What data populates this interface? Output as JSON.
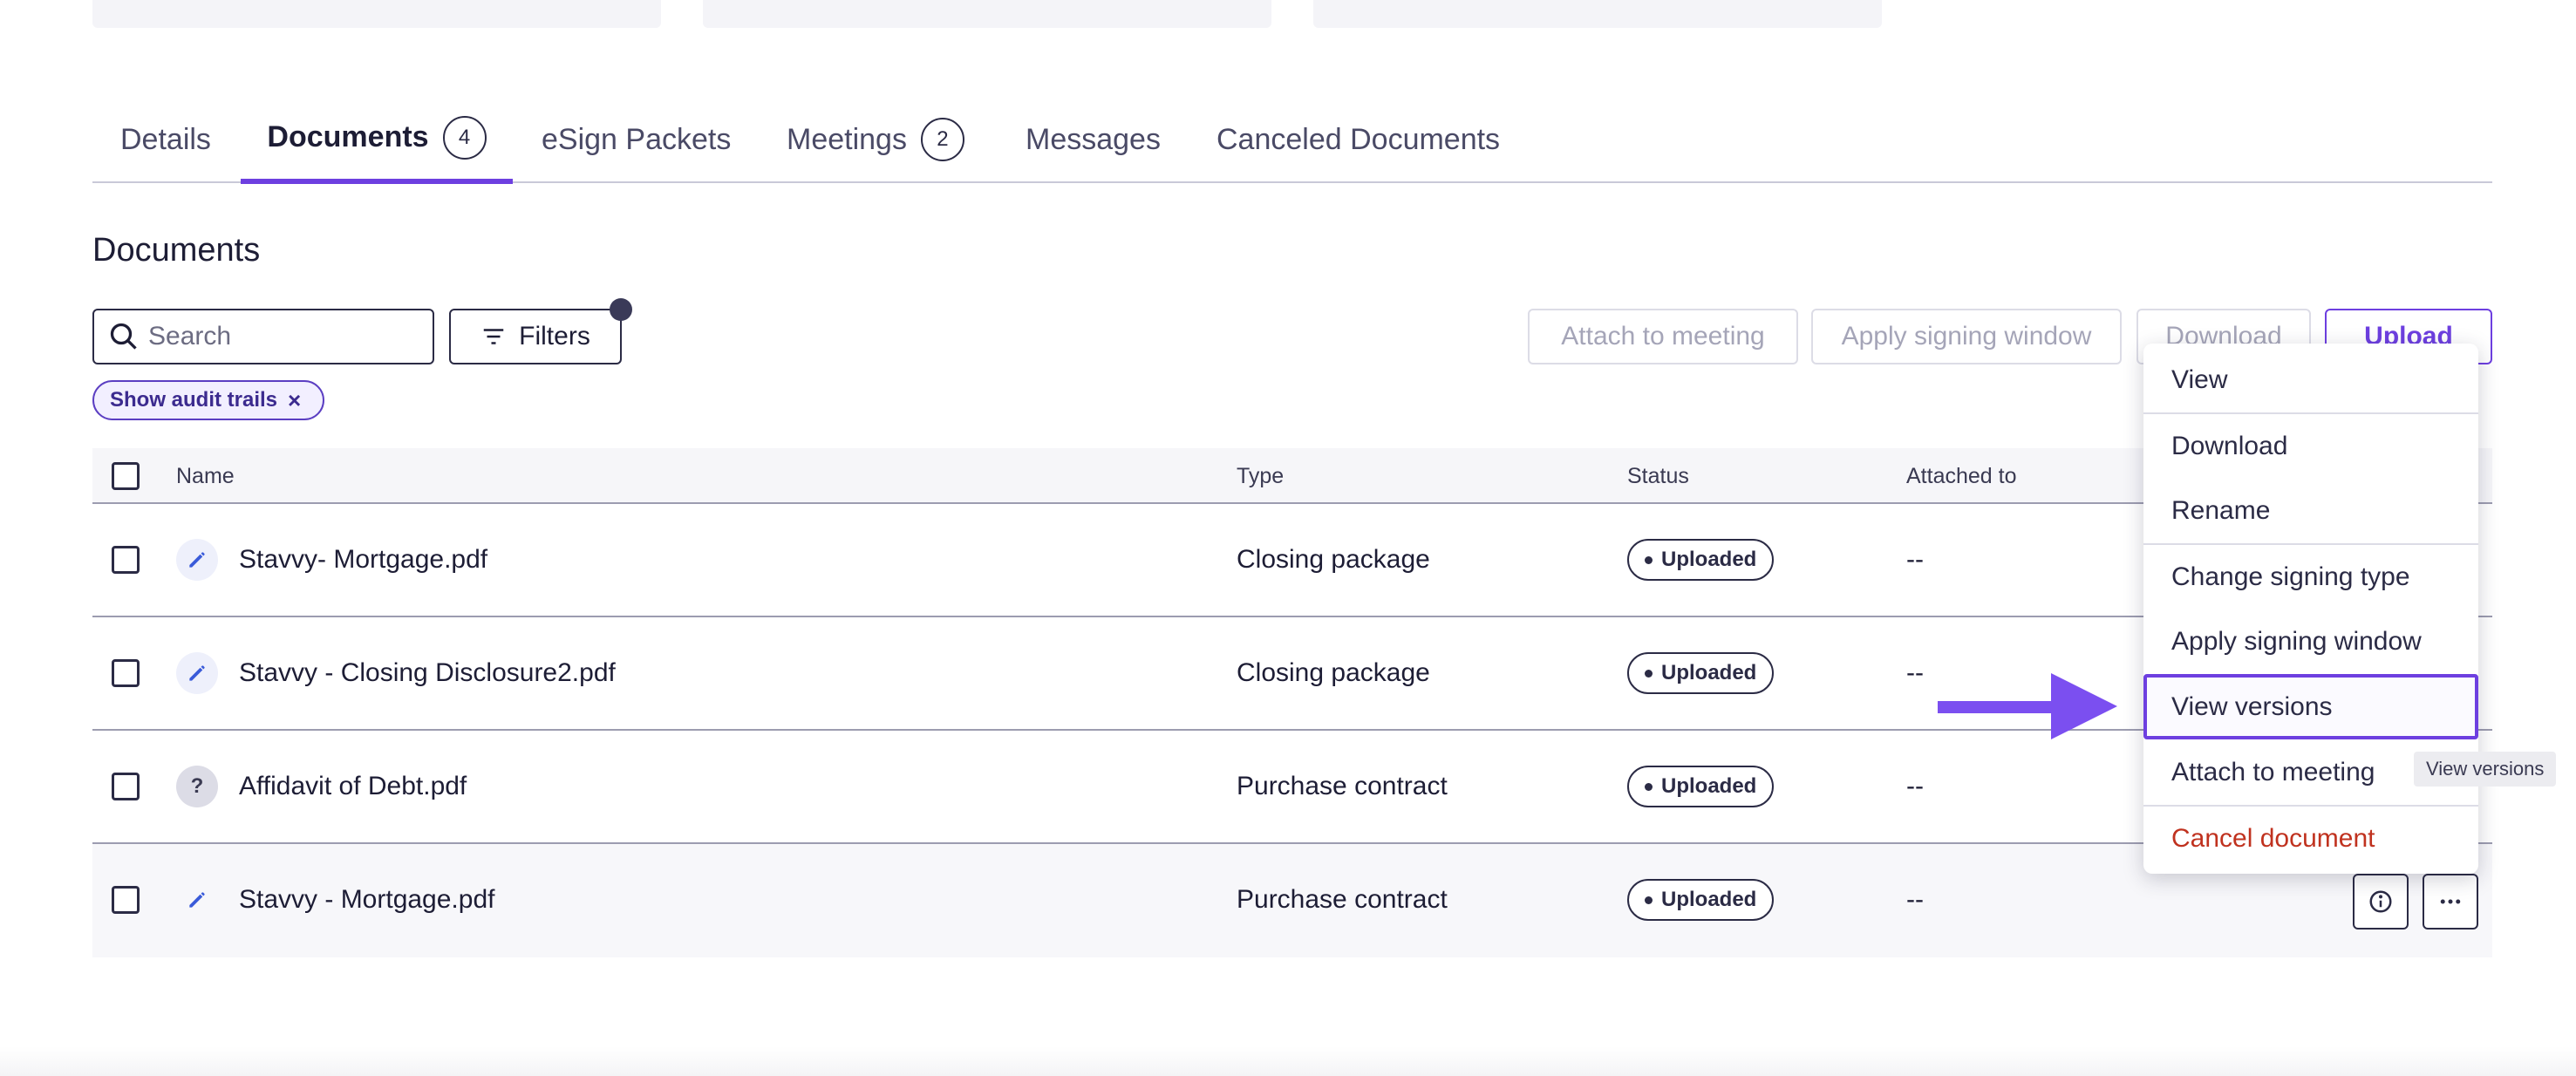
{
  "tabs": [
    {
      "label": "Details",
      "count": null
    },
    {
      "label": "Documents",
      "count": "4"
    },
    {
      "label": "eSign Packets",
      "count": null
    },
    {
      "label": "Meetings",
      "count": "2"
    },
    {
      "label": "Messages",
      "count": null
    },
    {
      "label": "Canceled Documents",
      "count": null
    }
  ],
  "section_title": "Documents",
  "toolbar": {
    "search_placeholder": "Search",
    "filters_label": "Filters",
    "attach_label": "Attach to meeting",
    "apply_window_label": "Apply signing window",
    "download_label": "Download",
    "upload_label": "Upload"
  },
  "active_filter": {
    "label": "Show audit trails",
    "remove": "×"
  },
  "table": {
    "headers": {
      "name": "Name",
      "type": "Type",
      "status": "Status",
      "attached": "Attached to"
    },
    "rows": [
      {
        "icon": "pencil-icon",
        "name": "Stavvy- Mortgage.pdf",
        "type": "Closing package",
        "status": "Uploaded",
        "attached": "--"
      },
      {
        "icon": "pencil-icon",
        "name": "Stavvy - Closing Disclosure2.pdf",
        "type": "Closing package",
        "status": "Uploaded",
        "attached": "--"
      },
      {
        "icon": "question-icon",
        "icon_text": "?",
        "name": "Affidavit of Debt.pdf",
        "type": "Purchase contract",
        "status": "Uploaded",
        "attached": "--"
      },
      {
        "icon": "pencil-icon",
        "name": "Stavvy - Mortgage.pdf",
        "type": "Purchase contract",
        "status": "Uploaded",
        "attached": "--"
      }
    ]
  },
  "menu": {
    "items": [
      "View",
      "Download",
      "Rename",
      "Change signing type",
      "Apply signing window",
      "View versions",
      "Attach to meeting",
      "Cancel document"
    ]
  },
  "tooltip": "View versions",
  "colors": {
    "accent": "#6d3fe0",
    "danger": "#c0321f",
    "text": "#1d1d35"
  }
}
